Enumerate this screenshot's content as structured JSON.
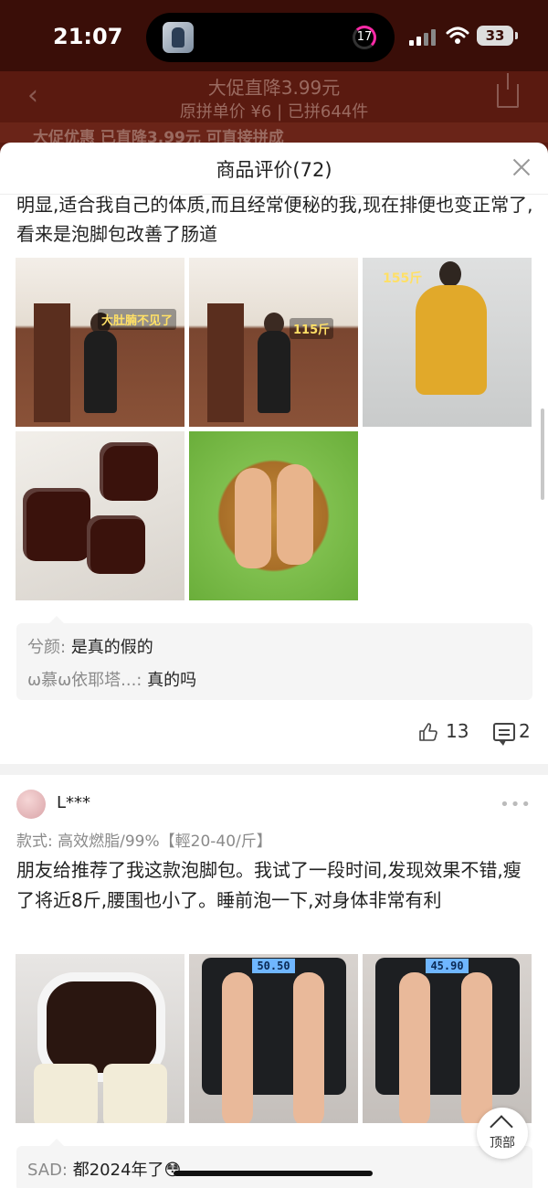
{
  "status_bar": {
    "time": "21:07",
    "timer_count": "17",
    "battery": "33"
  },
  "product_header": {
    "promo_line1": "大促直降3.99元",
    "promo_line2": "原拼单价 ¥6 | 已拼644件",
    "strip_text": "大促优惠   已直降3.99元   可直接拼成"
  },
  "sheet": {
    "title": "商品评价(72)"
  },
  "review1": {
    "text_continued": "明显,适合我自己的体质,而且经常便秘的我,现在排便也变正常了,看来是泡脚包改善了肠道",
    "photo_captions": [
      "大肚腩不见了",
      "115斤",
      "155斤"
    ],
    "comments": [
      {
        "user": "兮颜:",
        "text": "是真的假的"
      },
      {
        "user": "ω慕ω依耶塔...:",
        "text": "真的吗"
      }
    ],
    "likes": "13",
    "comment_count": "2"
  },
  "review2": {
    "username": "L***",
    "spec": "款式: 高效燃脂/99%【輕20-40/斤】",
    "text": "朋友给推荐了我这款泡脚包。我试了一段时间,发现效果不错,瘦了将近8斤,腰围也小了。睡前泡一下,对身体非常有利",
    "scale_readings": [
      "50.50",
      "45.90"
    ],
    "comments": [
      {
        "user": "SAD:",
        "text": "都2024年了😳"
      }
    ]
  },
  "floating": {
    "top_label": "顶部"
  },
  "icons": [
    "back-icon",
    "share-icon",
    "close-icon",
    "like-icon",
    "comment-icon",
    "more-icon",
    "arrow-up-icon",
    "wifi-icon",
    "signal-icon"
  ],
  "colors": {
    "header_bg": "#5a1a10",
    "sheet_bg": "#ffffff",
    "comment_bg": "#f5f5f5",
    "muted_text": "#8a8a8a"
  }
}
